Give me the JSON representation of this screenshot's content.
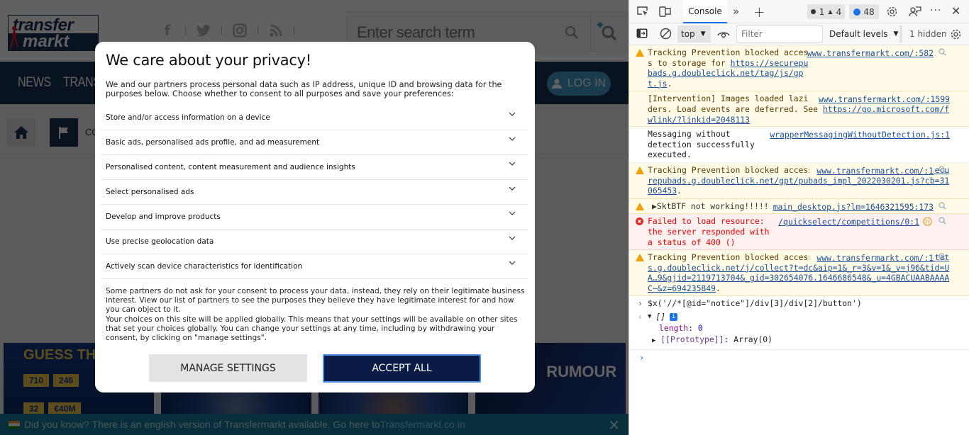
{
  "site": {
    "logo": {
      "line1": "transfer",
      "line2": "markt"
    },
    "social_icons": [
      "facebook-icon",
      "twitter-icon",
      "instagram-icon",
      "rss-icon"
    ],
    "search": {
      "placeholder": "Enter search term"
    },
    "nav": {
      "items": [
        "NEWS",
        "TRANSF"
      ],
      "login_label": "LOG IN"
    },
    "breadcrumb_label": "CO",
    "tiles": {
      "guess_title": "GUESS THE L",
      "stats_row1": [
        "710",
        "246"
      ],
      "stats_row2": [
        "32",
        "€40M"
      ],
      "rumour_title": "RUMOUR"
    },
    "banner": {
      "text": "Did you know? There is an english version of Transfermarkt available. Go here to",
      "link": "Transfermarkt.co.in",
      "close": "✕"
    }
  },
  "consent": {
    "title": "We care about your privacy!",
    "intro": "We and our partners process personal data such as IP address, unique ID and browsing data for the purposes below. Choose whether to consent to all purposes and save your preferences:",
    "purposes": [
      "Store and/or access information on a device",
      "Basic ads, personalised ads profile, and ad measurement",
      "Personalised content, content measurement and audience insights",
      "Select personalised ads",
      "Develop and improve products",
      "Use precise geolocation data",
      "Actively scan device characteristics for identification"
    ],
    "note_1": "Some partners do not ask for your consent to process your data, instead, they rely on their legitimate business interest. View our list of partners to see the purposes they believe they have legitimate interest for and how you can object to it.",
    "note_2": "Your choices on this site will be applied globally. This means that your settings will be available on other sites that set your choices globally. You can change your settings at any time, including by withdrawing your consent, by clicking on \"manage settings\".",
    "manage_label": "MANAGE SETTINGS",
    "accept_label": "ACCEPT ALL"
  },
  "devtools": {
    "tab": "Console",
    "errors": "1",
    "warnings": "4",
    "messages": "48",
    "context": "top",
    "filter_placeholder": "Filter",
    "levels": "Default levels",
    "hidden": "1 hidden",
    "logs": [
      {
        "level": "warning",
        "text": "Tracking Prevention blocked access to storage for ",
        "url": "https://securepubads.g.doubleclick.net/tag/js/gpt.js",
        "suffix": ".",
        "source": "www.transfermarkt.com/:582"
      },
      {
        "level": "warning",
        "text": "[Intervention] Images loaded lazily and replaced with placeholders. Load events are deferred. See ",
        "url": "https://go.microsoft.com/fwlink/?linkid=2048113",
        "suffix": "",
        "source": "www.transfermarkt.com/:1599"
      },
      {
        "level": "info",
        "text": "Messaging without detection successfully executed.",
        "source": "wrapperMessagingWithoutDetection.js:1"
      },
      {
        "level": "warning",
        "text": "Tracking Prevention blocked access to storage for ",
        "url": "https://securepubads.g.doubleclick.net/gpt/pubads_impl_2022030201.js?cb=31065453",
        "suffix": ".",
        "source": "www.transfermarkt.com/:1"
      },
      {
        "level": "warning",
        "text": "▶SktBTF not working!!!!!",
        "source": "main_desktop.js?lm=1646321595:173"
      },
      {
        "level": "error",
        "text": "Failed to load resource: the server responded with a status of 400 ()",
        "source": "/quickselect/competitions/0:1"
      },
      {
        "level": "warning",
        "text": "Tracking Prevention blocked access to storage for ",
        "url": "https://stats.g.doubleclick.net/j/collect?t=dc&aip=1&_r=3&v=1&_v=j96&tid=UA…9&gjid=2119713704&_gid=302654076.1646686548&_u=4GBACUAABAAAAC~&z=694235849",
        "suffix": ".",
        "source": "www.transfermarkt.com/:1"
      }
    ],
    "command": "$x('//*[@id=\"notice\"]/div[3]/div[2]/button')",
    "result": {
      "summary": "[]",
      "length_key": "length",
      "length_val": "0",
      "proto_key": "[[Prototype]]",
      "proto_val": "Array(0)"
    }
  }
}
